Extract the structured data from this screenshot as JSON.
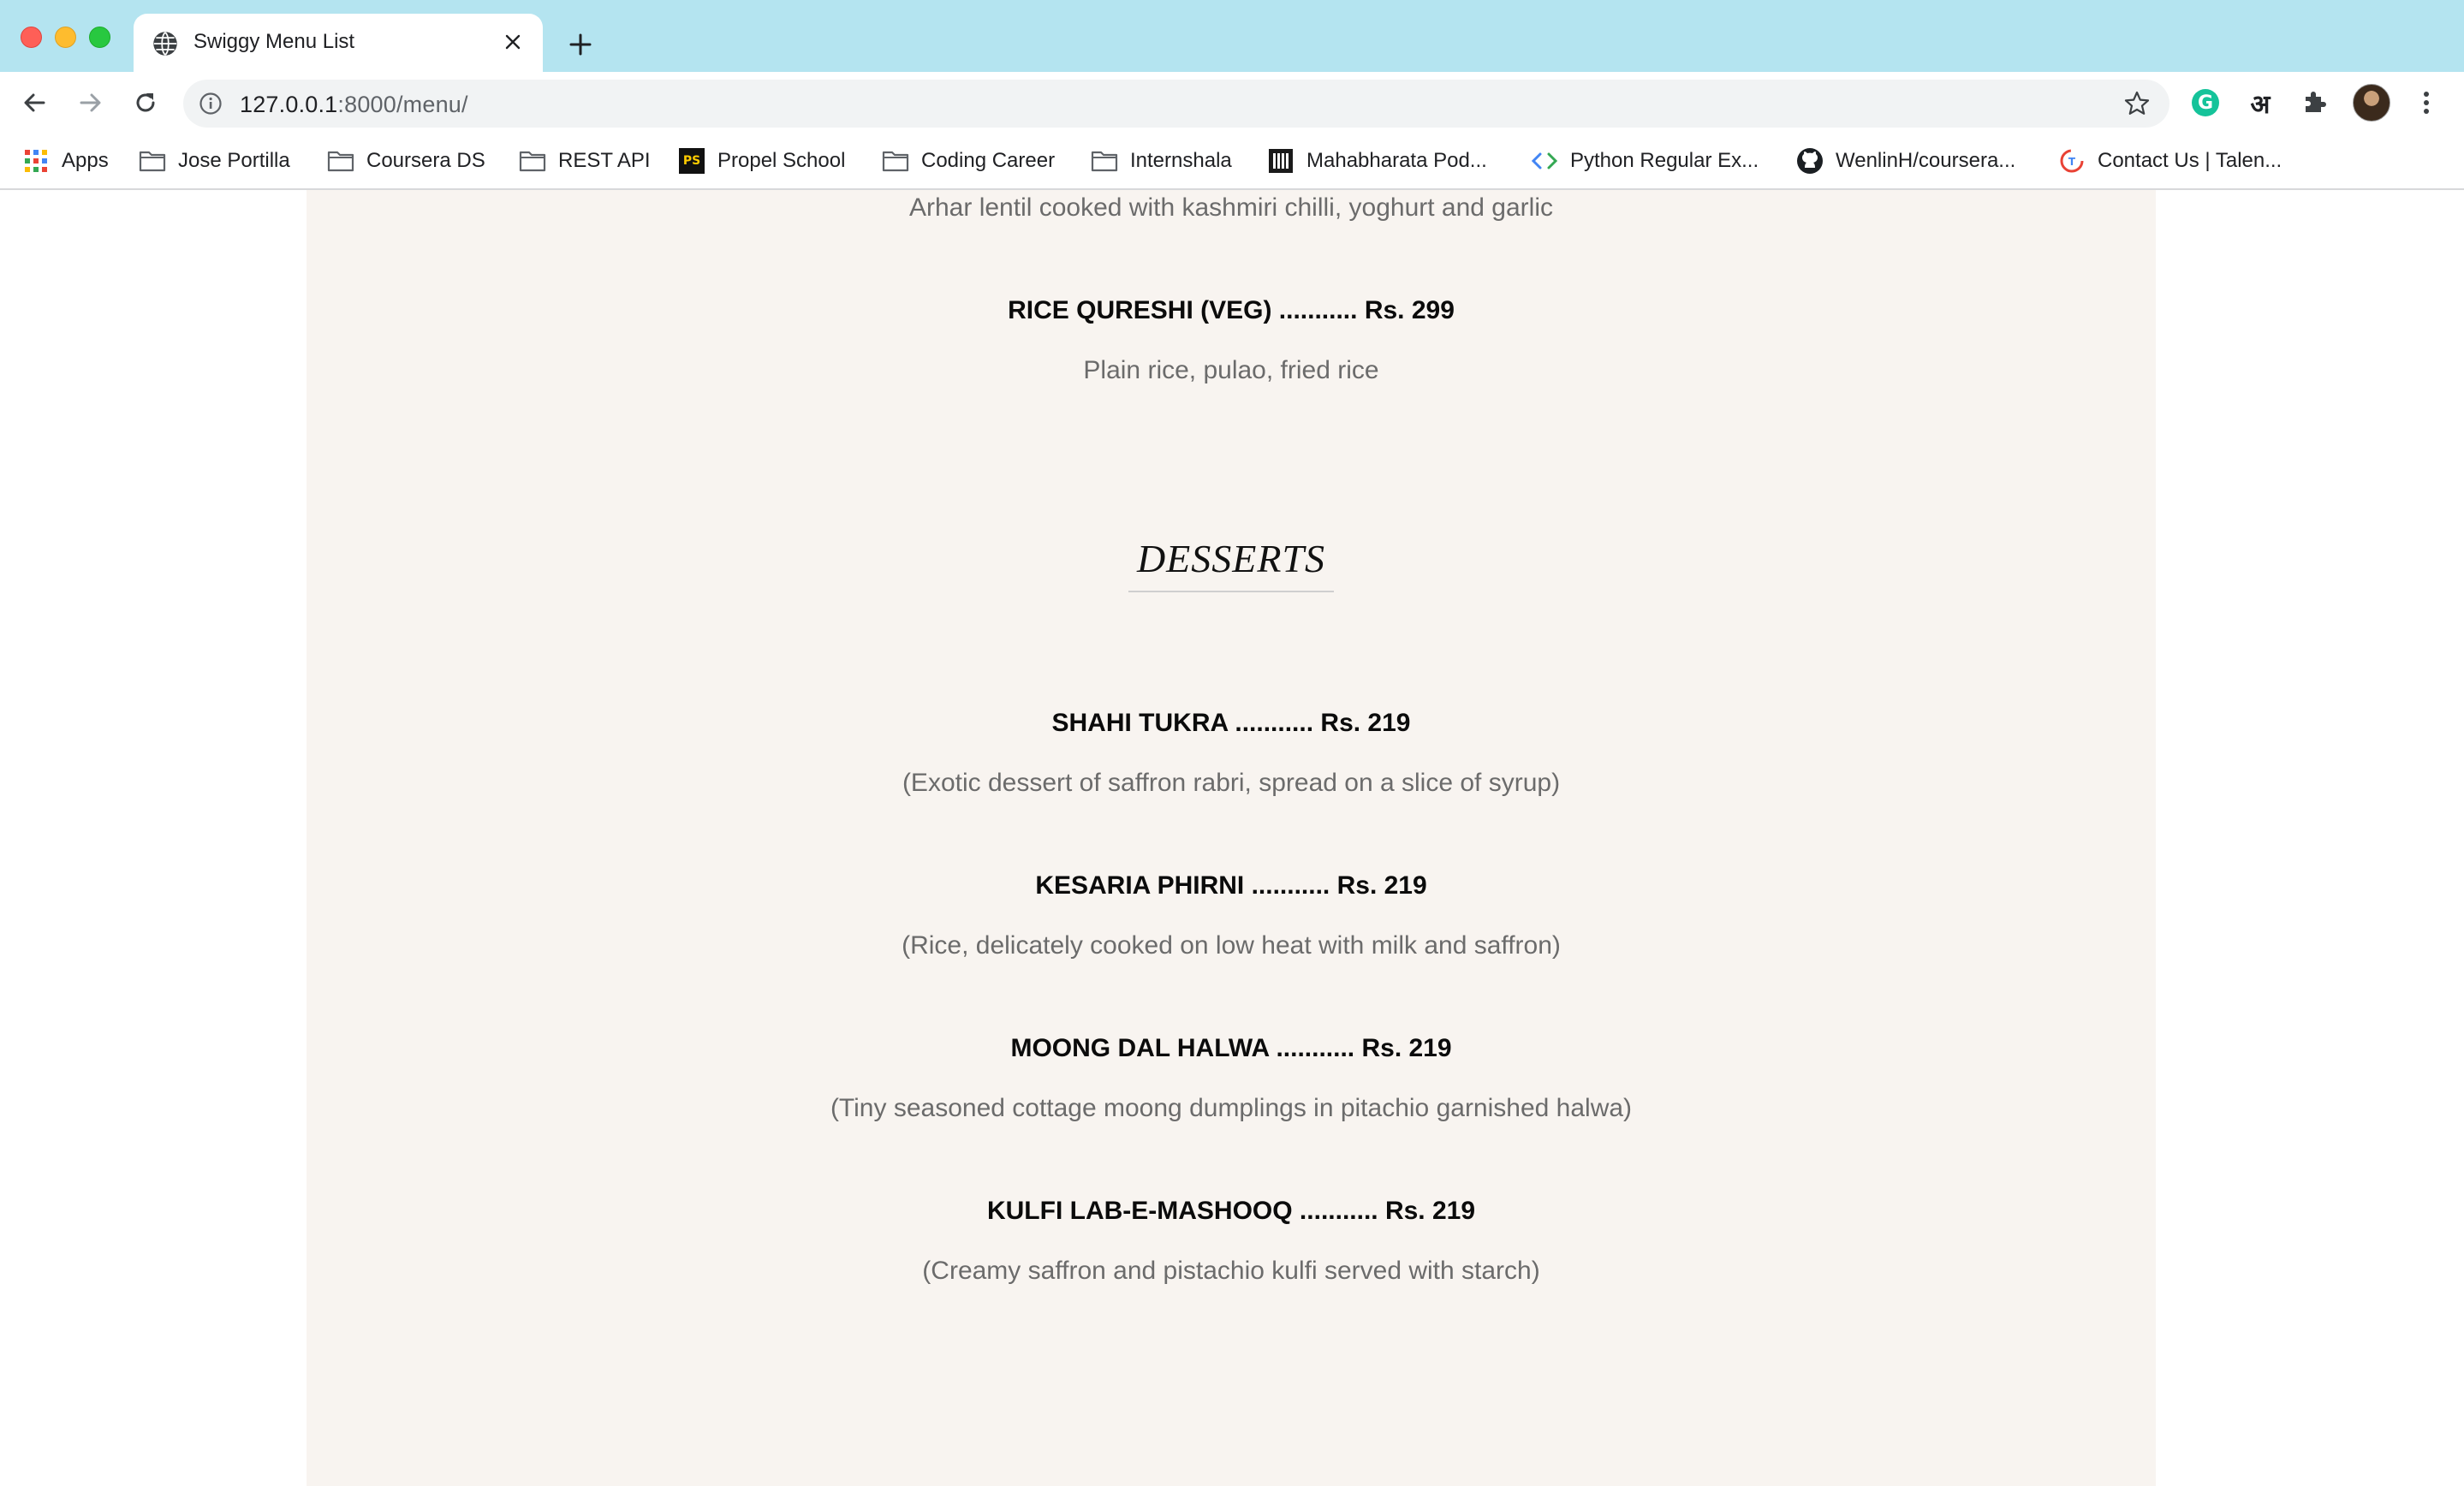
{
  "browser": {
    "tab": {
      "title": "Swiggy Menu List"
    },
    "omnibox": {
      "url_host": "127.0.0.1",
      "url_rest": ":8000/menu/"
    },
    "extensions": {
      "hindi_glyph": "अ"
    },
    "bookmarks": [
      {
        "label": "Apps",
        "icon": "apps-grid-icon"
      },
      {
        "label": "Jose Portilla",
        "icon": "folder-icon"
      },
      {
        "label": "Coursera DS",
        "icon": "folder-icon"
      },
      {
        "label": "REST API",
        "icon": "folder-icon"
      },
      {
        "label": "Propel School",
        "icon": "propel-school-icon"
      },
      {
        "label": "Coding Career",
        "icon": "folder-icon"
      },
      {
        "label": "Internshala",
        "icon": "folder-icon"
      },
      {
        "label": "Mahabharata Pod...",
        "icon": "podcast-icon"
      },
      {
        "label": "Python Regular Ex...",
        "icon": "code-icon"
      },
      {
        "label": "WenlinH/coursera...",
        "icon": "github-icon"
      },
      {
        "label": "Contact Us | Talen...",
        "icon": "talent-icon"
      }
    ]
  },
  "menu": {
    "top_description": "Arhar lentil cooked with kashmiri chilli, yoghurt and garlic",
    "rice_item": {
      "title": "RICE QURESHI (VEG) ........... Rs. 299",
      "description": "Plain rice, pulao, fried rice"
    },
    "desserts": {
      "heading": "DESSERTS",
      "items": [
        {
          "title": "SHAHI TUKRA ........... Rs. 219",
          "description": "(Exotic dessert of saffron rabri, spread on a slice of syrup)"
        },
        {
          "title": "KESARIA PHIRNI ........... Rs. 219",
          "description": "(Rice, delicately cooked on low heat with milk and saffron)"
        },
        {
          "title": "MOONG DAL HALWA ........... Rs. 219",
          "description": "(Tiny seasoned cottage moong dumplings in pitachio garnished halwa)"
        },
        {
          "title": "KULFI LAB-E-MASHOOQ ........... Rs. 219",
          "description": "(Creamy saffron and pistachio kulfi served with starch)"
        }
      ]
    }
  },
  "colors": {
    "tabstrip": "#b4e4f0",
    "panel_bg": "#f8f4f0",
    "desc_text": "#6b6b6b",
    "title_text": "#0b0b0b"
  }
}
